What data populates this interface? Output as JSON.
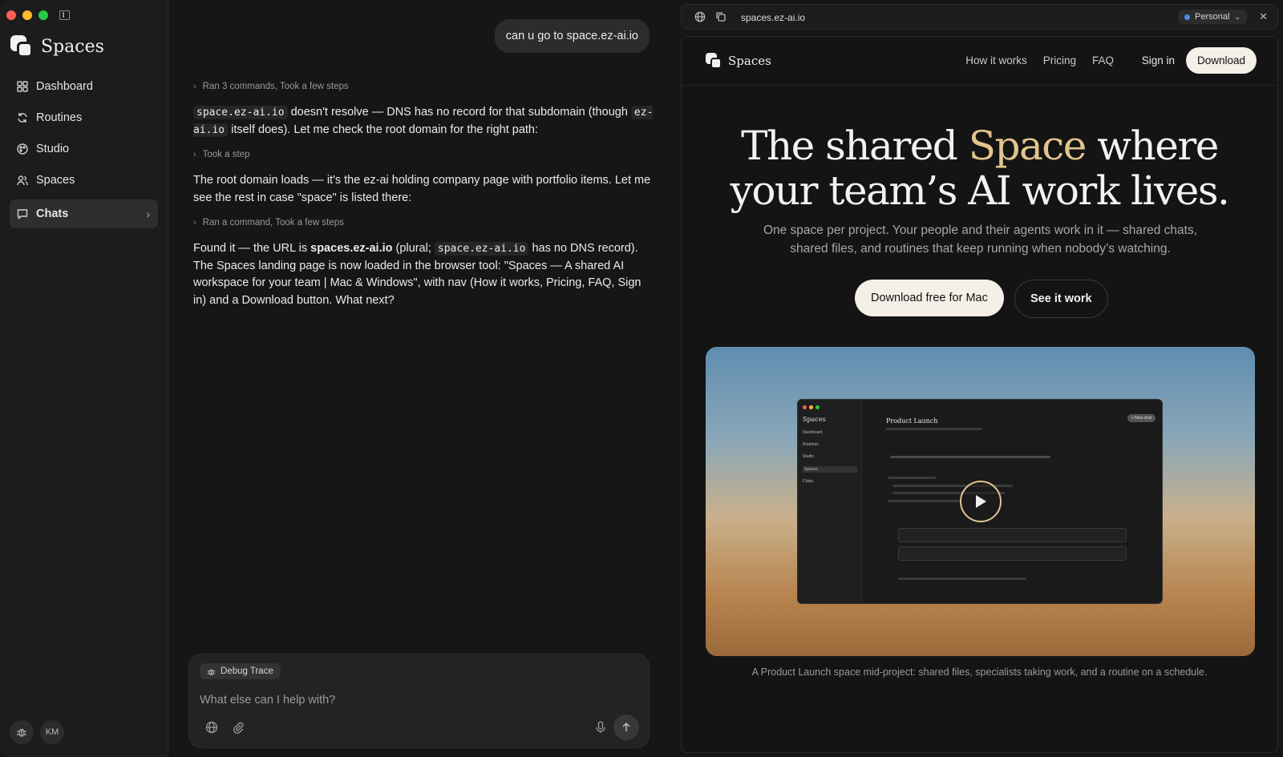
{
  "sidebar": {
    "brand": "Spaces",
    "items": [
      {
        "label": "Dashboard",
        "icon": "grid-icon"
      },
      {
        "label": "Routines",
        "icon": "refresh-icon"
      },
      {
        "label": "Studio",
        "icon": "palette-icon"
      },
      {
        "label": "Spaces",
        "icon": "users-icon"
      },
      {
        "label": "Chats",
        "icon": "chat-icon"
      }
    ],
    "user_initials": "KM"
  },
  "chat": {
    "user_message": "can u go to space.ez-ai.io",
    "step1": "Ran 3 commands, Took a few steps",
    "msg1": {
      "code1": "space.ez-ai.io",
      "text1": " doesn't resolve — DNS has no record for that subdomain (though ",
      "code2": "ez-ai.io",
      "text2": " itself does). Let me check the root domain for the right path:"
    },
    "step2": "Took a step",
    "msg2": "The root domain loads — it's the ez-ai holding company page with portfolio items. Let me see the rest in case \"space\" is listed there:",
    "step3": "Ran a command, Took a few steps",
    "msg3": {
      "lead": "Found it — the URL is ",
      "bold": "spaces.ez-ai.io",
      "mid": " (plural; ",
      "code": "space.ez-ai.io",
      "rest": " has no DNS record). The Spaces landing page is now loaded in the browser tool: \"Spaces — A shared AI workspace for your team | Mac & Windows\", with nav (How it works, Pricing, FAQ, Sign in) and a Download button. What next?"
    },
    "composer": {
      "chip": "Debug Trace",
      "placeholder": "What else can I help with?"
    }
  },
  "browser": {
    "url": "spaces.ez-ai.io",
    "profile": "Personal",
    "site": {
      "brand": "Spaces",
      "nav_links": [
        "How it works",
        "Pricing",
        "FAQ"
      ],
      "sign_in": "Sign in",
      "download": "Download",
      "hero_line1_a": "The shared ",
      "hero_accent": "Space",
      "hero_line1_b": " where",
      "hero_line2": "your team’s AI work lives.",
      "subtitle": "One space per project. Your people and their agents work in it — shared chats, shared files, and routines that keep running when nobody’s watching.",
      "cta_primary": "Download free for Mac",
      "cta_secondary": "See it work",
      "caption": "A Product Launch space mid-project: shared files, specialists taking work, and a routine on a schedule.",
      "mock": {
        "brand": "Spaces",
        "title": "Product Launch",
        "new_chat": "+ New chat",
        "nav": [
          "Dashboard",
          "Routines",
          "Studio",
          "Spaces",
          "Chats"
        ]
      }
    },
    "accent_color": "#e2c58d"
  }
}
